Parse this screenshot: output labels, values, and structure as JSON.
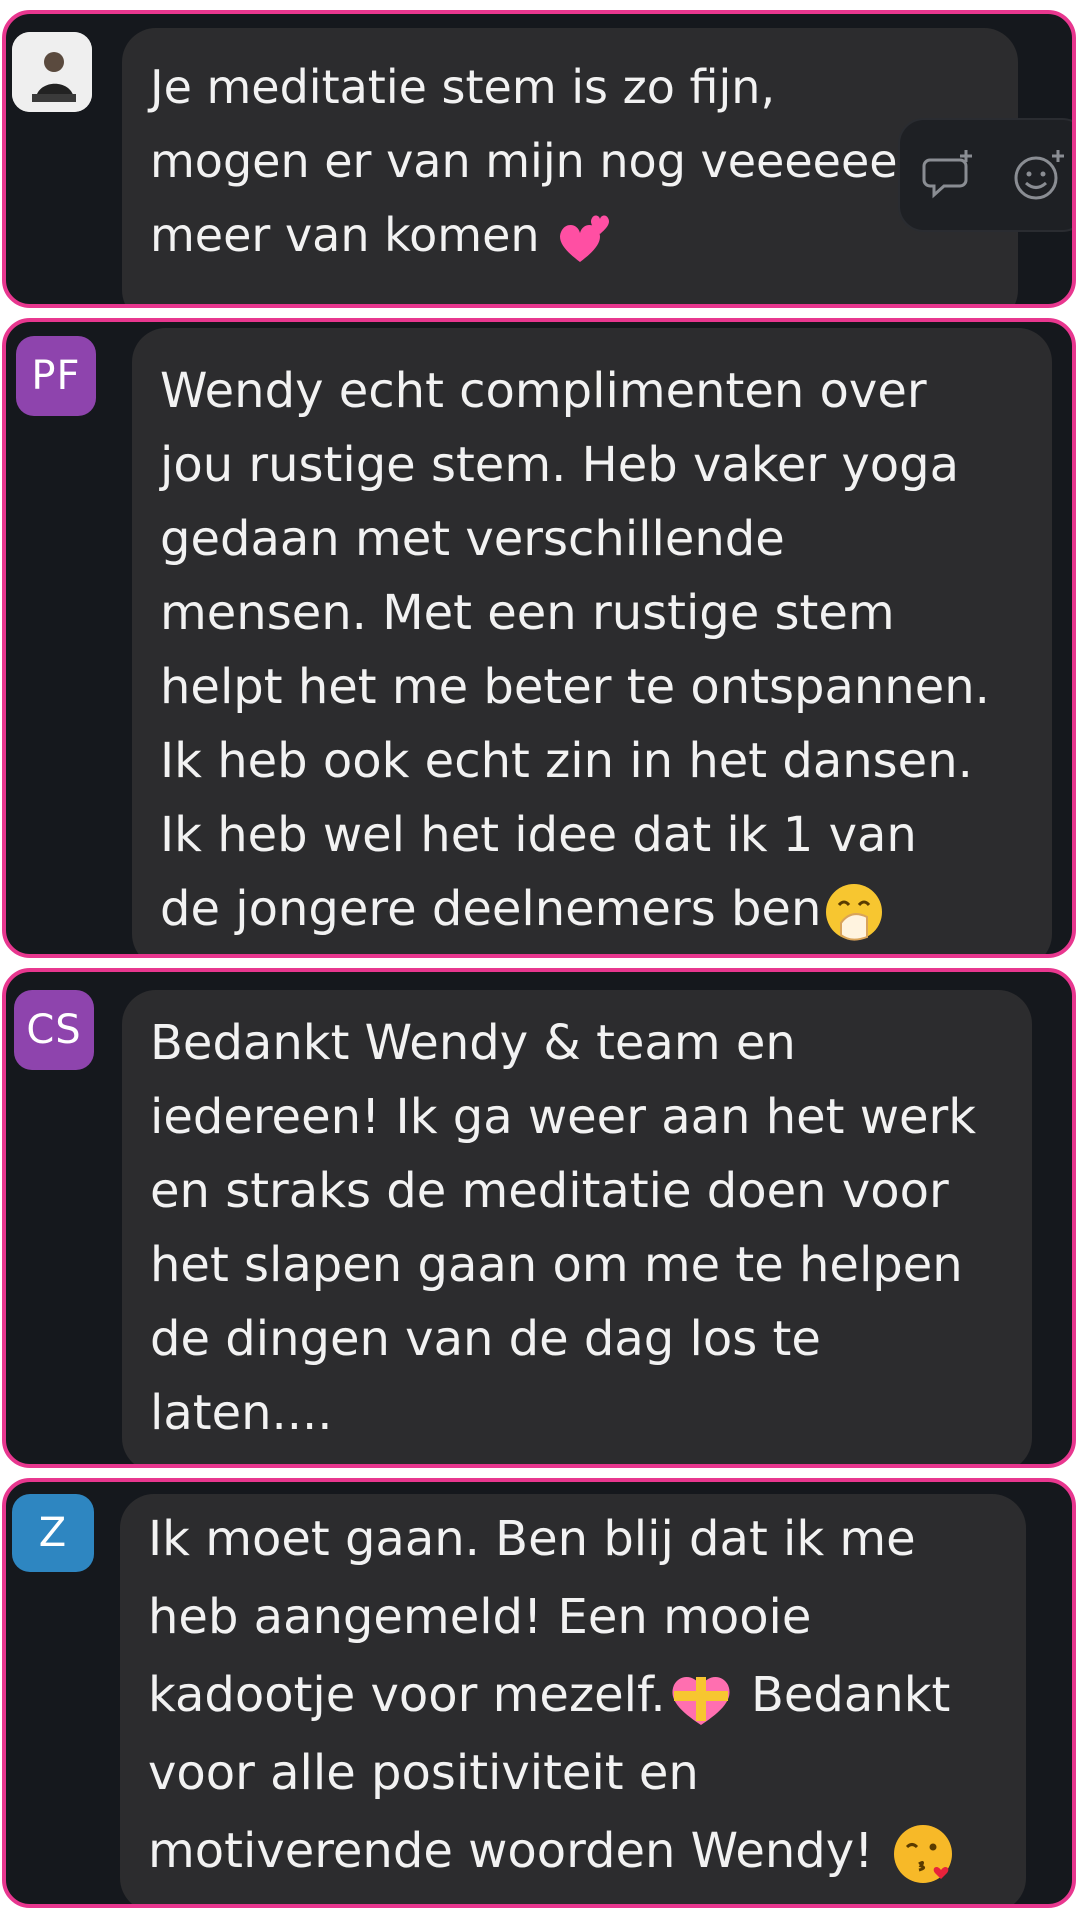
{
  "messages": [
    {
      "avatar_kind": "photo",
      "avatar_initials": "",
      "avatar_color": "#f2f2f2",
      "lines": [
        "Je meditatie stem is zo fijn,",
        "mogen er van mijn nog veeeeee",
        "meer van komen"
      ],
      "trailing_emoji": "two-hearts-emoji"
    },
    {
      "avatar_kind": "initials",
      "avatar_initials": "PF",
      "avatar_color": "#8e44ad",
      "lines": [
        "Wendy echt complimenten over",
        "jou rustige stem. Heb vaker yoga",
        "gedaan met verschillende",
        "mensen. Met een rustige stem",
        "helpt het me beter te ontspannen.",
        "Ik heb ook echt zin in het dansen.",
        "Ik heb wel het idee dat ik 1 van",
        "de jongere deelnemers ben"
      ],
      "trailing_emoji": "hand-over-mouth-emoji"
    },
    {
      "avatar_kind": "initials",
      "avatar_initials": "CS",
      "avatar_color": "#8e44ad",
      "lines": [
        "Bedankt Wendy & team en",
        "iedereen! Ik ga weer aan het werk",
        "en straks de meditatie doen voor",
        "het slapen gaan om me te helpen",
        "de dingen van de dag los te",
        "laten...."
      ],
      "trailing_emoji": ""
    },
    {
      "avatar_kind": "initials",
      "avatar_initials": "Z",
      "avatar_color": "#2e86c1",
      "lines": [
        "Ik moet gaan. Ben blij dat ik me",
        "heb aangemeld! Een mooie",
        "kadootje voor mezelf.",
        "Bedankt",
        "voor alle positiviteit en",
        "motiverende woorden Wendy!"
      ],
      "trailing_emoji": "kissing-face-emoji",
      "inline_emoji": "heart-with-ribbon-emoji"
    }
  ],
  "hover_toolbar": {
    "icons": [
      "reply-in-thread-icon",
      "add-reaction-icon"
    ]
  }
}
